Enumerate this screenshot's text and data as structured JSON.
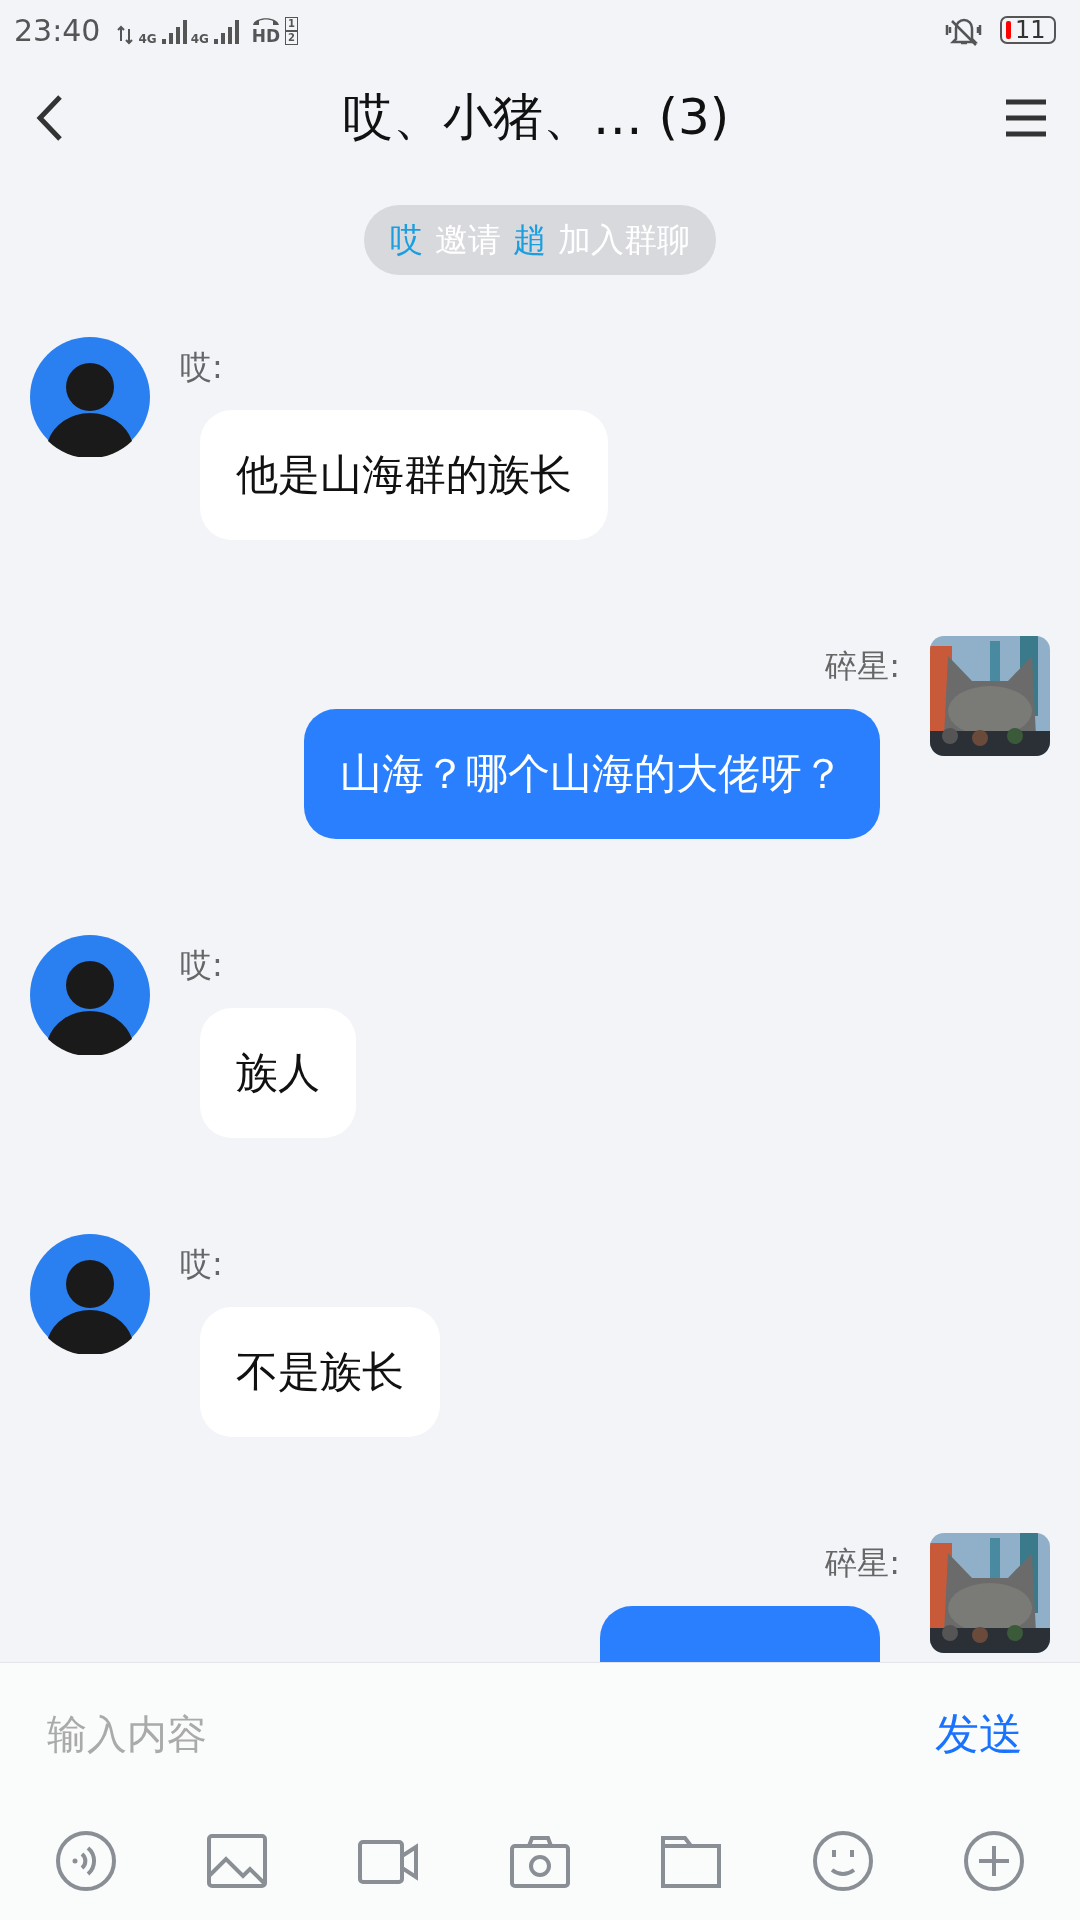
{
  "status_bar": {
    "time": "23:40",
    "signal_labels": [
      "4G",
      "4G"
    ],
    "hd_label": "HD",
    "sim_labels": [
      "1",
      "2"
    ],
    "battery": "11"
  },
  "header": {
    "title": "哎、小猪、… (3)"
  },
  "notice": [
    {
      "text": "哎",
      "kind": "name"
    },
    {
      "text": "邀请",
      "kind": "plain"
    },
    {
      "text": "趙",
      "kind": "name"
    },
    {
      "text": "加入群聊",
      "kind": "plain"
    }
  ],
  "messages": [
    {
      "kind": "incoming",
      "sender": "哎:",
      "text": "他是山海群的族长"
    },
    {
      "kind": "outgoing",
      "sender": "碎星:",
      "text": "山海？哪个山海的大佬呀？"
    },
    {
      "kind": "incoming",
      "sender": "哎:",
      "text": "族人"
    },
    {
      "kind": "incoming",
      "sender": "哎:",
      "text": "不是族长"
    },
    {
      "kind": "outgoing",
      "sender": "碎星:"
    }
  ],
  "composer": {
    "placeholder": "输入内容",
    "send": "发送"
  }
}
